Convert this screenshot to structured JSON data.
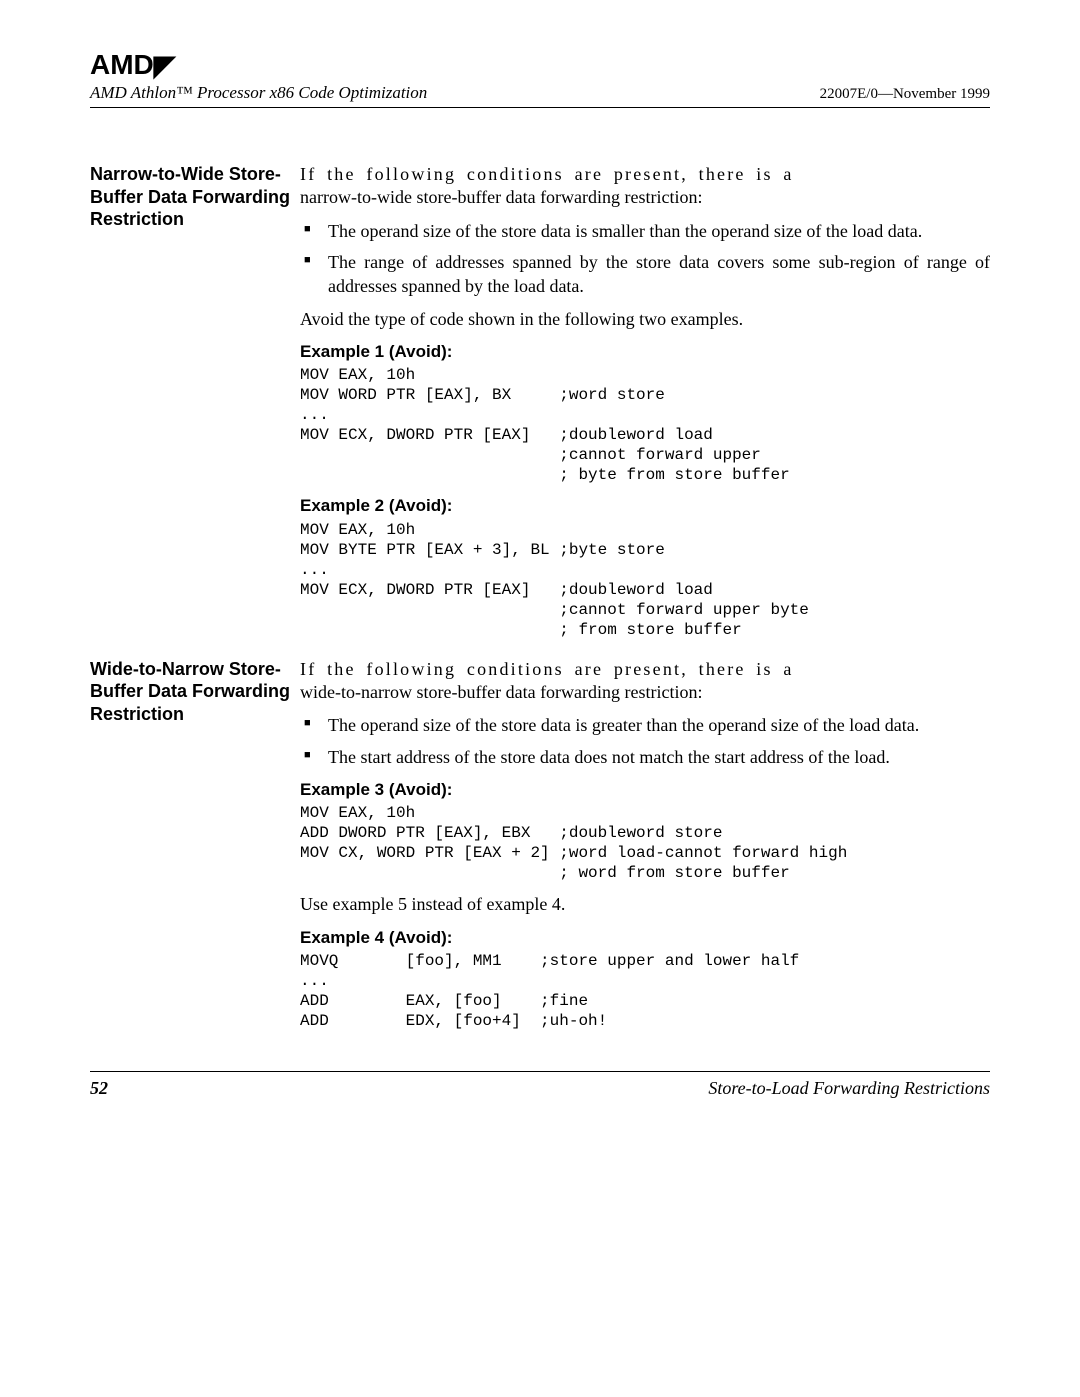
{
  "header": {
    "logo_text": "AMD",
    "doc_title": "AMD Athlon™ Processor x86 Code Optimization",
    "doc_id": "22007E/0—November 1999"
  },
  "sections": [
    {
      "heading": "Narrow-to-Wide Store-Buffer Data Forwarding Restriction",
      "intro_line1": "If the following conditions are present, there is a",
      "intro_line2": "narrow-to-wide store-buffer data forwarding restriction:",
      "bullets": [
        "The operand size of the store data is smaller than the operand size of the load data.",
        "The range of addresses spanned by the store data covers some sub-region of range of addresses spanned by the load data."
      ],
      "post_bullets": "Avoid the type of code shown in the following two examples.",
      "examples": [
        {
          "title": "Example 1 (Avoid):",
          "code": "MOV EAX, 10h\nMOV WORD PTR [EAX], BX     ;word store\n...\nMOV ECX, DWORD PTR [EAX]   ;doubleword load\n                           ;cannot forward upper\n                           ; byte from store buffer"
        },
        {
          "title": "Example 2 (Avoid):",
          "code": "MOV EAX, 10h\nMOV BYTE PTR [EAX + 3], BL ;byte store\n...\nMOV ECX, DWORD PTR [EAX]   ;doubleword load\n                           ;cannot forward upper byte\n                           ; from store buffer"
        }
      ]
    },
    {
      "heading": "Wide-to-Narrow Store-Buffer Data Forwarding Restriction",
      "intro_line1": "If the following conditions are present, there is a",
      "intro_line2": "wide-to-narrow store-buffer data forwarding restriction:",
      "bullets": [
        "The operand size of the store data is greater than the operand size of the load data.",
        "The start address of the store data does not match the start address of the load."
      ],
      "post_bullets": "",
      "examples": [
        {
          "title": "Example 3 (Avoid):",
          "code": "MOV EAX, 10h\nADD DWORD PTR [EAX], EBX   ;doubleword store\nMOV CX, WORD PTR [EAX + 2] ;word load-cannot forward high\n                           ; word from store buffer"
        }
      ],
      "post_example_text": "Use example 5 instead of example 4.",
      "examples2": [
        {
          "title": "Example 4 (Avoid):",
          "code": "MOVQ       [foo], MM1    ;store upper and lower half\n...\nADD        EAX, [foo]    ;fine\nADD        EDX, [foo+4]  ;uh-oh!"
        }
      ]
    }
  ],
  "footer": {
    "page_number": "52",
    "section_title": "Store-to-Load Forwarding Restrictions"
  }
}
